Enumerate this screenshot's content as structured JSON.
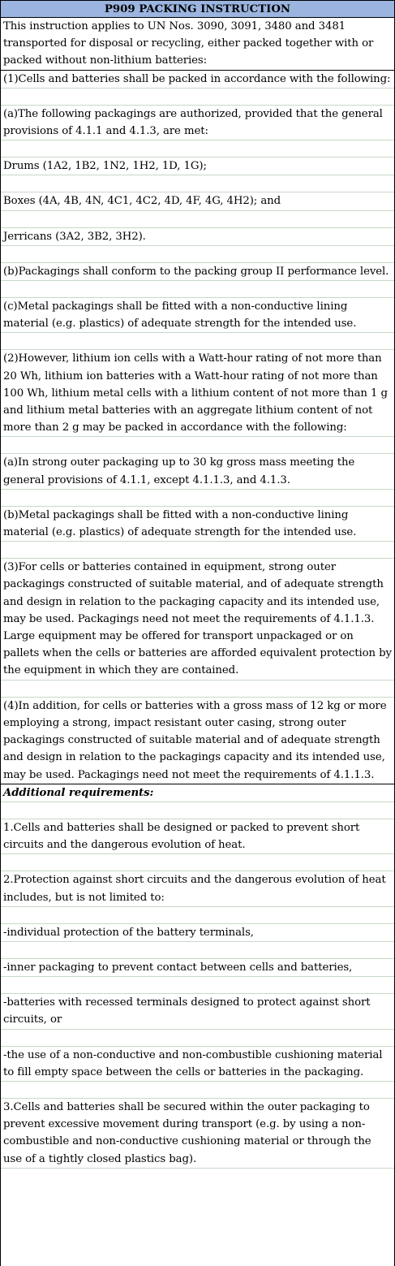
{
  "title": "P909 PACKING INSTRUCTION",
  "rows": [
    {
      "text": "This instruction applies to UN Nos. 3090, 3091, 3480 and 3481 transported for disposal or recycling, either packed together with or packed without non-lithium batteries:",
      "style": "thick"
    },
    {
      "text": "(1)Cells and batteries shall be packed in accordance with the following:"
    },
    {
      "text": ""
    },
    {
      "text": "(a)The following packagings are authorized, provided that the general provisions of 4.1.1 and 4.1.3, are met:"
    },
    {
      "text": ""
    },
    {
      "text": "Drums (1A2, 1B2, 1N2, 1H2, 1D, 1G);"
    },
    {
      "text": ""
    },
    {
      "text": "Boxes (4A, 4B, 4N, 4C1, 4C2, 4D, 4F, 4G, 4H2); and"
    },
    {
      "text": ""
    },
    {
      "text": "Jerricans (3A2, 3B2, 3H2)."
    },
    {
      "text": ""
    },
    {
      "text": "(b)Packagings shall conform to the packing group II performance level."
    },
    {
      "text": ""
    },
    {
      "text": "(c)Metal packagings shall be fitted with a non-conductive lining material (e.g. plastics) of adequate strength for the intended use."
    },
    {
      "text": ""
    },
    {
      "text": "(2)However, lithium ion cells with a Watt-hour rating of not more than 20 Wh, lithium ion batteries with a Watt-hour rating of not more than 100 Wh, lithium metal cells with a lithium content of not more than 1 g and lithium metal batteries with an aggregate lithium content of not more than 2 g may be packed in accordance with the following:"
    },
    {
      "text": ""
    },
    {
      "text": "(a)In strong outer packaging up to 30 kg gross mass meeting the general provisions of 4.1.1, except 4.1.1.3, and 4.1.3."
    },
    {
      "text": ""
    },
    {
      "text": "(b)Metal packagings shall be fitted with a non-conductive lining material (e.g. plastics) of adequate strength for the intended use."
    },
    {
      "text": ""
    },
    {
      "text": "(3)For cells or batteries contained in equipment, strong outer packagings constructed of suitable material, and of adequate strength and design in relation to the packaging capacity and its intended use, may be used. Packagings need not meet the requirements of 4.1.1.3. Large equipment may be offered for transport unpackaged or on pallets when the cells or batteries are afforded equivalent protection by the equipment in which they are contained."
    },
    {
      "text": ""
    },
    {
      "text": "(4)In addition, for cells or batteries with a gross mass of 12 kg or more employing a strong, impact resistant outer casing, strong outer packagings constructed of suitable material and of adequate strength and design in relation to the packagings capacity and its intended use, may be used. Packagings need not meet the requirements of 4.1.1.3.",
      "style": "thick"
    },
    {
      "text": "Additional requirements:",
      "style": "italic"
    },
    {
      "text": ""
    },
    {
      "text": "1.Cells and batteries shall be designed or packed to prevent short circuits and the dangerous evolution of heat."
    },
    {
      "text": ""
    },
    {
      "text": "2.Protection against short circuits and the dangerous evolution of heat includes, but is not limited to:"
    },
    {
      "text": ""
    },
    {
      "text": "-individual protection of the battery terminals,"
    },
    {
      "text": ""
    },
    {
      "text": "-inner packaging to prevent contact between cells and batteries,"
    },
    {
      "text": ""
    },
    {
      "text": "-batteries with recessed terminals designed to protect against short circuits, or"
    },
    {
      "text": ""
    },
    {
      "text": "-the use of a non-conductive and non-combustible cushioning material to fill empty space between the cells or batteries in the packaging."
    },
    {
      "text": ""
    },
    {
      "text": "3.Cells and batteries shall be secured within the outer packaging to prevent excessive movement during transport (e.g. by using a non-combustible and non-conductive cushioning material or through the use of a tightly closed plastics bag)."
    }
  ]
}
